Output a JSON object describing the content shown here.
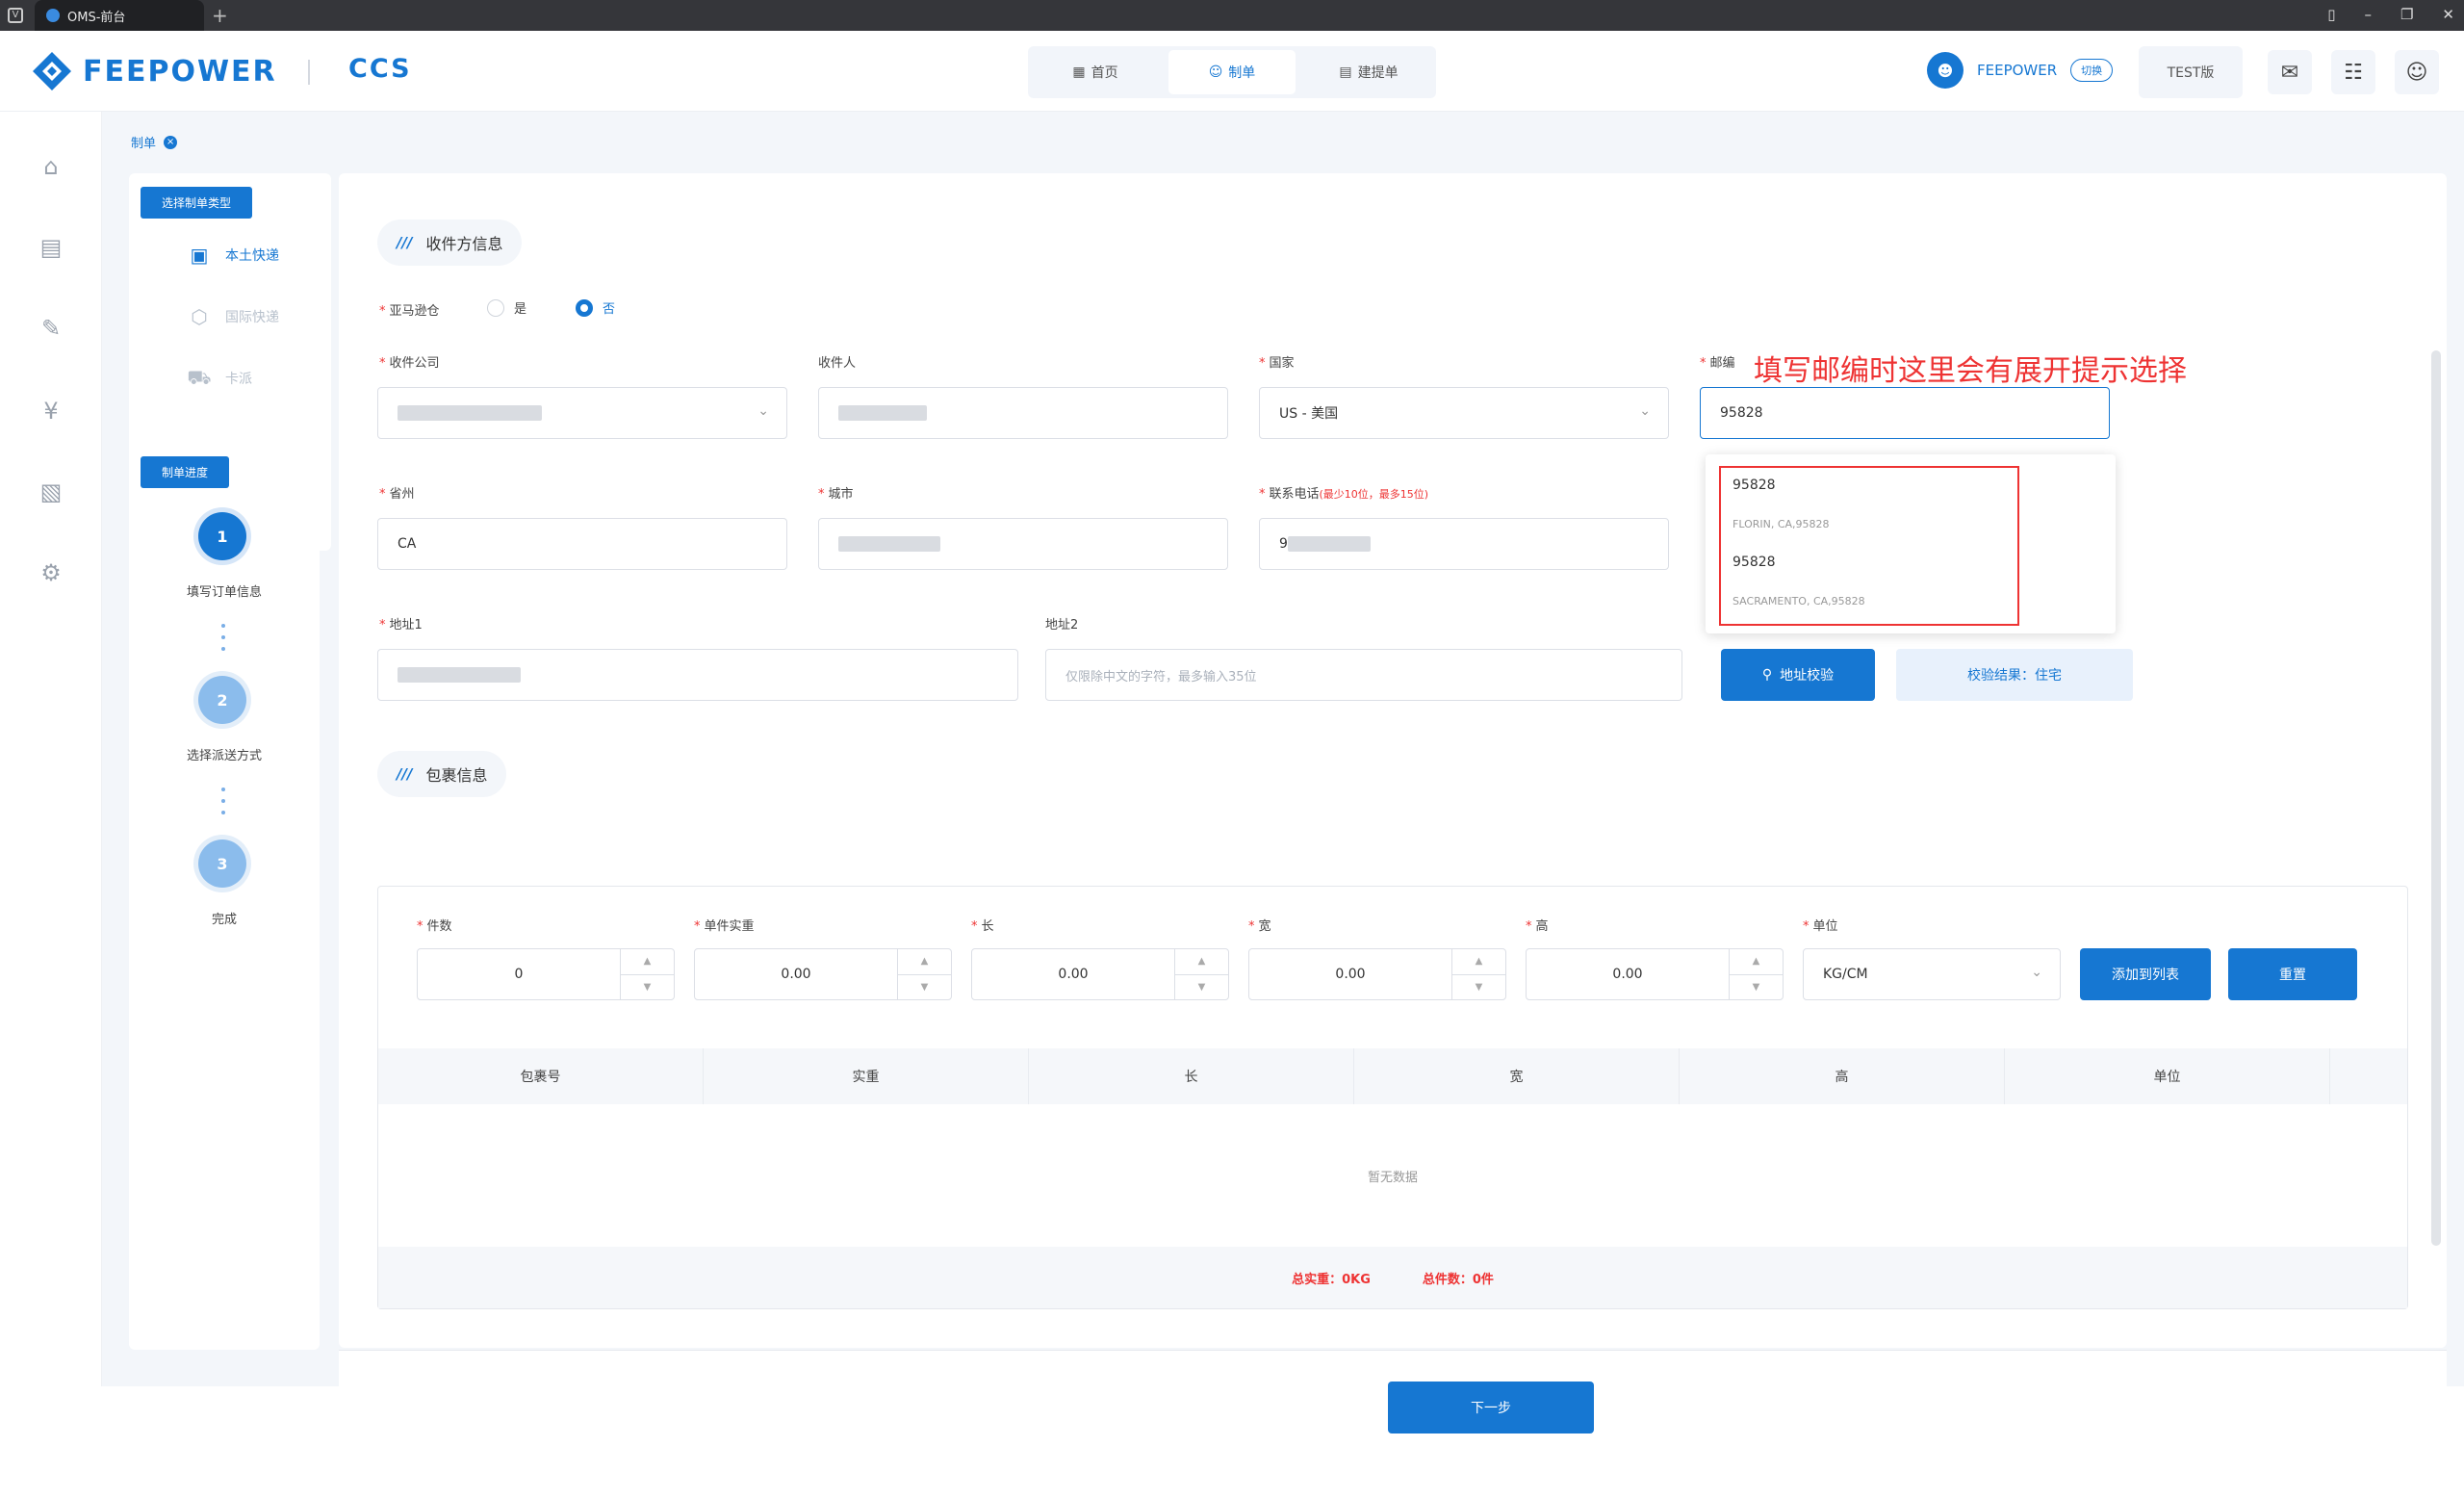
{
  "browser": {
    "tab_title": "OMS-前台",
    "new_tab": "+",
    "app_icon": "V"
  },
  "header": {
    "logo_text": "FEEPOWER",
    "logo_sub": "CCS",
    "nav": [
      {
        "label": "首页",
        "icon": "grid-icon"
      },
      {
        "label": "制单",
        "icon": "person-icon"
      },
      {
        "label": "建提单",
        "icon": "doc-icon"
      }
    ],
    "user_name": "FEEPOWER",
    "switch_label": "切换",
    "version": "TEST版"
  },
  "breadcrumb": {
    "tag": "制单",
    "close": "×"
  },
  "type_panel": {
    "title": "选择制单类型",
    "items": [
      {
        "label": "本土快递",
        "active": true
      },
      {
        "label": "国际快递",
        "active": false
      },
      {
        "label": "卡派",
        "active": false
      }
    ]
  },
  "progress": {
    "title": "制单进度",
    "steps": [
      {
        "num": "1",
        "label": "填写订单信息"
      },
      {
        "num": "2",
        "label": "选择派送方式"
      },
      {
        "num": "3",
        "label": "完成"
      }
    ]
  },
  "recipient": {
    "section_title": "收件方信息",
    "amazon_label": "亚马逊仓",
    "yes": "是",
    "no": "否",
    "company_label": "收件公司",
    "contact_label": "收件人",
    "country_label": "国家",
    "country_value": "US - 美国",
    "zip_label": "邮编",
    "zip_value": "95828",
    "state_label": "省州",
    "state_value": "CA",
    "city_label": "城市",
    "phone_label": "联系电话",
    "phone_hint": "(最少10位，最多15位)",
    "phone_value": "9",
    "addr1_label": "地址1",
    "addr2_label": "地址2",
    "addr2_placeholder": "仅限除中文的字符，最多输入35位",
    "verify_btn": "地址校验",
    "verify_result": "校验结果：住宅"
  },
  "zip_suggestions": [
    {
      "code": "95828",
      "city": "FLORIN, CA,95828"
    },
    {
      "code": "95828",
      "city": "SACRAMENTO, CA,95828"
    }
  ],
  "annotation": "填写邮编时这里会有展开提示选择",
  "package": {
    "section_title": "包裹信息",
    "fields": [
      {
        "label": "件数",
        "value": "0"
      },
      {
        "label": "单件实重",
        "value": "0.00"
      },
      {
        "label": "长",
        "value": "0.00"
      },
      {
        "label": "宽",
        "value": "0.00"
      },
      {
        "label": "高",
        "value": "0.00"
      }
    ],
    "unit_label": "单位",
    "unit_value": "KG/CM",
    "add_btn": "添加到列表",
    "reset_btn": "重置",
    "columns": [
      "包裹号",
      "实重",
      "长",
      "宽",
      "高",
      "单位"
    ],
    "empty_text": "暂无数据",
    "total_weight": "总实重：0KG",
    "total_count": "总件数：0件"
  },
  "next_btn": "下一步",
  "colors": {
    "primary": "#1677d2",
    "danger": "#e33333"
  }
}
